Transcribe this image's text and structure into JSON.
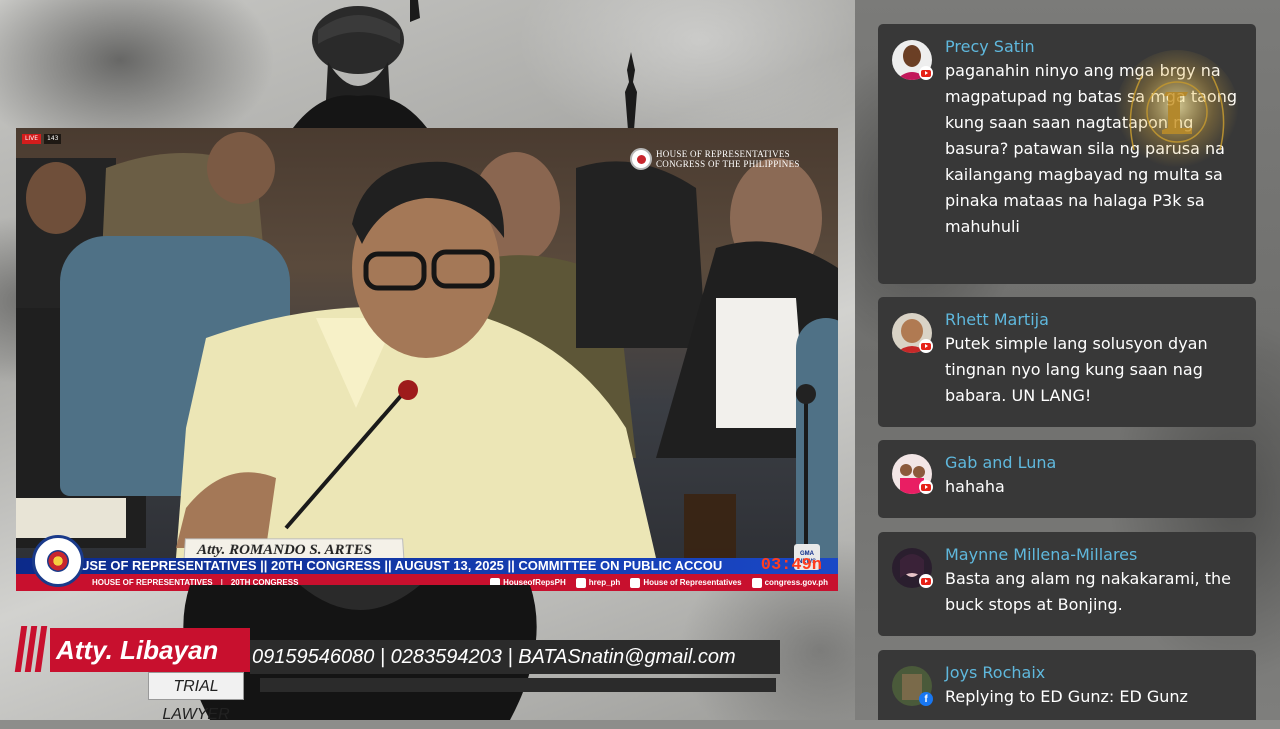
{
  "video": {
    "live_label": "LIVE",
    "viewer_count": "143",
    "broadcaster_line1": "HOUSE OF REPRESENTATIVES",
    "broadcaster_line2": "CONGRESS OF THE PHILIPPINES",
    "nameplate": "Atty. ROMANDO S. ARTES",
    "ticker": "USE OF REPRESENTATIVES || 20TH CONGRESS || AUGUST 13, 2025 ||  COMMITTEE ON PUBLIC ACCOU",
    "ticker_time": "03:49",
    "ticker_time_suffix": "n",
    "news_badge_line1": "GMA",
    "news_badge_line2": "NEWS",
    "subbar_left": "HOUSE OF REPRESENTATIVES",
    "subbar_sep": "|",
    "subbar_congress": "20TH CONGRESS",
    "social": [
      "HouseofRepsPH",
      "hrep_ph",
      "House of Representatives",
      "congress.gov.ph"
    ]
  },
  "lower_third": {
    "name": "Atty. Libayan",
    "title": "TRIAL LAWYER",
    "contact": "09159546080 | 0283594203 | BATASnatin@gmail.com"
  },
  "chat": {
    "messages": [
      {
        "author": "Precy Satin",
        "platform": "youtube",
        "text": "paganahin ninyo ang mga brgy na magpatupad ng batas sa mga taong kung saan saan nagtatapon ng basura? patawan sila ng parusa na kailangang magbayad ng multa sa pinaka mataas na halaga P3k sa mahuhuli"
      },
      {
        "author": "Rhett Martija",
        "platform": "youtube",
        "text": "Putek simple lang solusyon dyan tingnan nyo lang kung saan nag babara. UN LANG!"
      },
      {
        "author": "Gab and Luna",
        "platform": "youtube",
        "text": "hahaha"
      },
      {
        "author": "Maynne Millena-Millares",
        "platform": "youtube",
        "text": "Basta ang alam ng nakakarami, the buck stops at Bonjing."
      },
      {
        "author": "Joys Rochaix",
        "platform": "facebook",
        "text": "Replying to ED Gunz: ED Gunz"
      }
    ]
  },
  "colors": {
    "accent_red": "#c8102e",
    "ticker_blue": "#1a48c7",
    "chat_author": "#5fb8dd",
    "chat_bubble": "#383838"
  }
}
